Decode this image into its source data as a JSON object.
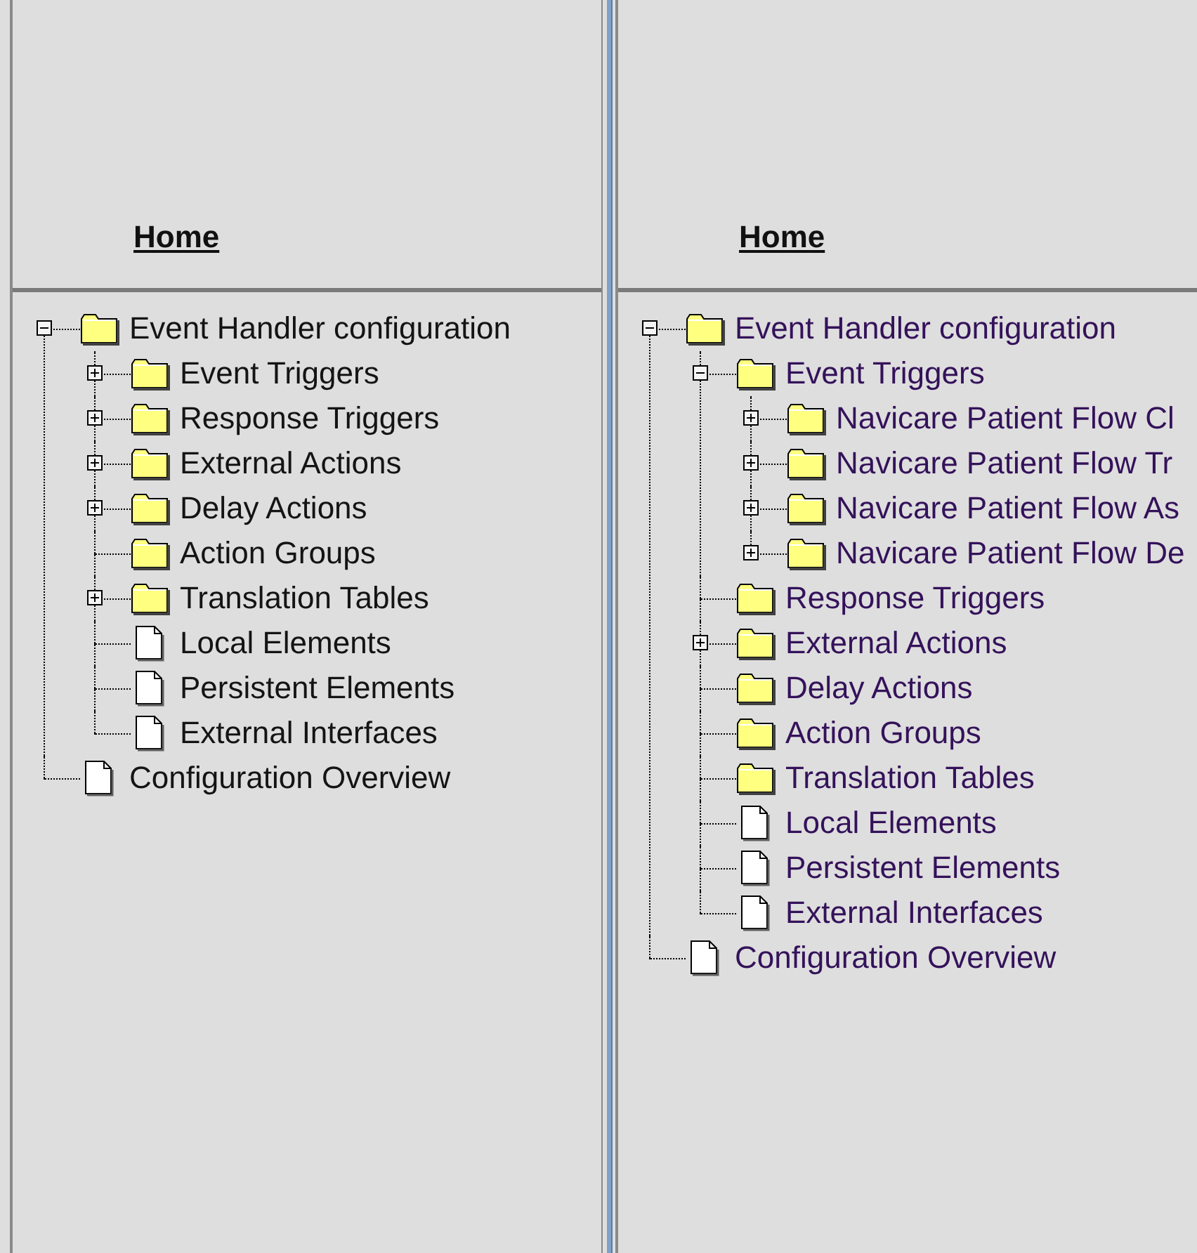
{
  "panels": [
    {
      "home_link": "Home",
      "visited": false,
      "tree": [
        {
          "label": "Event Handler configuration",
          "kind": "folder",
          "expanded": true,
          "children": [
            {
              "label": "Event Triggers",
              "kind": "folder",
              "expanded": false
            },
            {
              "label": "Response Triggers",
              "kind": "folder",
              "expanded": false
            },
            {
              "label": "External Actions",
              "kind": "folder",
              "expanded": false
            },
            {
              "label": "Delay Actions",
              "kind": "folder",
              "expanded": false
            },
            {
              "label": "Action Groups",
              "kind": "folder"
            },
            {
              "label": "Translation Tables",
              "kind": "folder",
              "expanded": false
            },
            {
              "label": "Local Elements",
              "kind": "document"
            },
            {
              "label": "Persistent Elements",
              "kind": "document"
            },
            {
              "label": "External Interfaces",
              "kind": "document"
            }
          ]
        },
        {
          "label": "Configuration Overview",
          "kind": "document"
        }
      ]
    },
    {
      "home_link": "Home",
      "visited": true,
      "tree": [
        {
          "label": "Event Handler configuration",
          "kind": "folder",
          "expanded": true,
          "children": [
            {
              "label": "Event Triggers",
              "kind": "folder",
              "expanded": true,
              "children": [
                {
                  "label": "Navicare Patient Flow Cl",
                  "kind": "folder",
                  "expanded": false
                },
                {
                  "label": "Navicare Patient Flow Tr",
                  "kind": "folder",
                  "expanded": false
                },
                {
                  "label": "Navicare Patient Flow As",
                  "kind": "folder",
                  "expanded": false
                },
                {
                  "label": "Navicare Patient Flow De",
                  "kind": "folder",
                  "expanded": false
                }
              ]
            },
            {
              "label": "Response Triggers",
              "kind": "folder"
            },
            {
              "label": "External Actions",
              "kind": "folder",
              "expanded": false
            },
            {
              "label": "Delay Actions",
              "kind": "folder"
            },
            {
              "label": "Action Groups",
              "kind": "folder"
            },
            {
              "label": "Translation Tables",
              "kind": "folder"
            },
            {
              "label": "Local Elements",
              "kind": "document"
            },
            {
              "label": "Persistent Elements",
              "kind": "document"
            },
            {
              "label": "External Interfaces",
              "kind": "document"
            }
          ]
        },
        {
          "label": "Configuration Overview",
          "kind": "document"
        }
      ]
    }
  ]
}
